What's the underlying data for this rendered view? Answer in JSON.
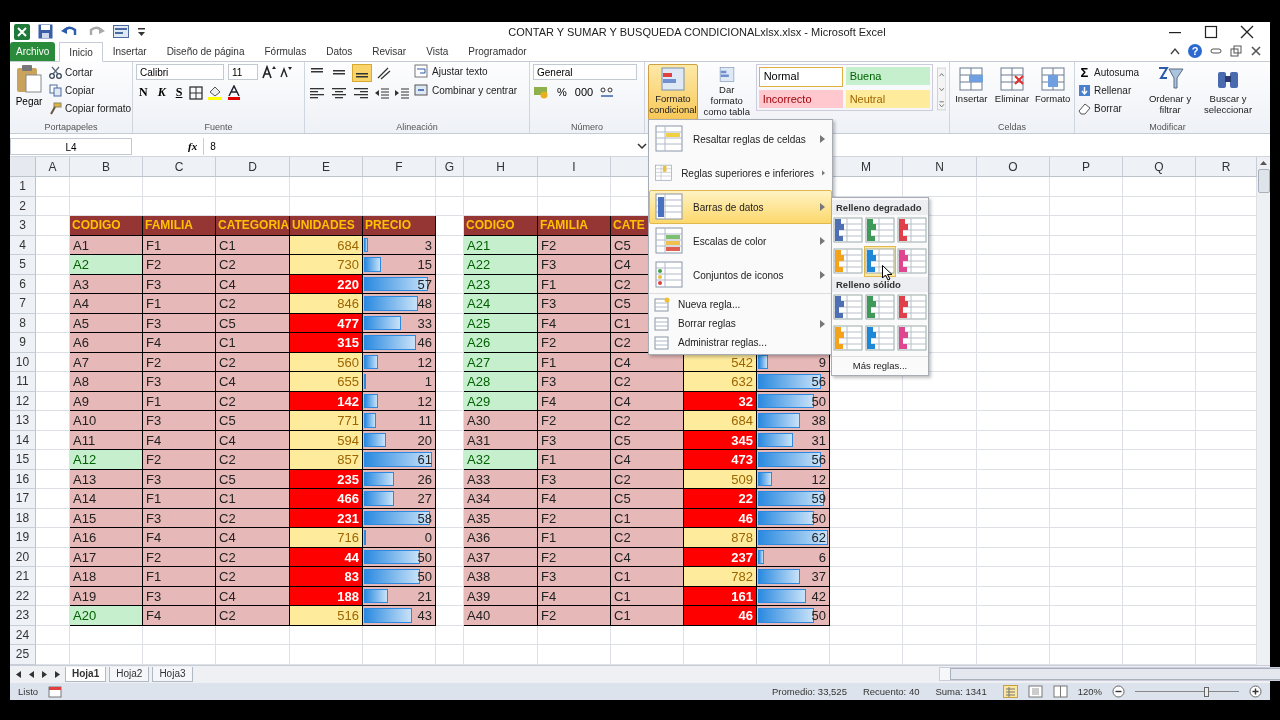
{
  "window": {
    "title": "CONTAR Y SUMAR Y BUSQUEDA CONDICIONALxlsx.xlsx  -  Microsoft Excel",
    "help": "?"
  },
  "tabs": [
    {
      "label": "Archivo",
      "kind": "file",
      "selected": false
    },
    {
      "label": "Inicio",
      "kind": "tab",
      "selected": true
    },
    {
      "label": "Insertar",
      "kind": "tab",
      "selected": false
    },
    {
      "label": "Diseño de página",
      "kind": "tab",
      "selected": false
    },
    {
      "label": "Fórmulas",
      "kind": "tab",
      "selected": false
    },
    {
      "label": "Datos",
      "kind": "tab",
      "selected": false
    },
    {
      "label": "Revisar",
      "kind": "tab",
      "selected": false
    },
    {
      "label": "Vista",
      "kind": "tab",
      "selected": false
    },
    {
      "label": "Programador",
      "kind": "tab",
      "selected": false
    }
  ],
  "ribbon": {
    "clipboard": {
      "paste": "Pegar",
      "items": [
        "Cortar",
        "Copiar",
        "Copiar formato"
      ],
      "label": "Portapapeles"
    },
    "font": {
      "family": "Calibri",
      "size": "11",
      "style_buttons": [
        "N",
        "K",
        "S"
      ],
      "label": "Fuente"
    },
    "alignment": {
      "wrap": "Ajustar texto",
      "merge": "Combinar y centrar",
      "label": "Alineación"
    },
    "number": {
      "format": "General",
      "symbols": [
        "%",
        "000"
      ],
      "label": "Número"
    },
    "styles": {
      "buttons": [
        {
          "label": "Formato condicional",
          "selected": true
        },
        {
          "label": "Dar formato como tabla",
          "selected": false
        }
      ],
      "cell_styles": [
        {
          "label": "Normal",
          "kind": "normal"
        },
        {
          "label": "Buena",
          "kind": "good"
        },
        {
          "label": "Incorrecto",
          "kind": "bad"
        },
        {
          "label": "Neutral",
          "kind": "neutral"
        }
      ]
    },
    "cells": {
      "buttons": [
        "Insertar",
        "Eliminar",
        "Formato"
      ],
      "label": "Celdas"
    },
    "editing": {
      "autosum_symbol": "Σ",
      "items": [
        "Autosuma",
        "Rellenar",
        "Borrar"
      ],
      "buttons": [
        "Ordenar y filtrar",
        "Buscar y seleccionar"
      ],
      "label": "Modificar"
    }
  },
  "formula_bar": {
    "name_box": "L4",
    "function_label": "fx",
    "value": "8"
  },
  "sheet": {
    "columns": [
      "A",
      "B",
      "C",
      "D",
      "E",
      "F",
      "G",
      "H",
      "I",
      null,
      null,
      null,
      "M",
      "N",
      "O",
      "P",
      "Q",
      "R"
    ],
    "rows": [
      "1",
      "2",
      "3",
      "4",
      "5",
      "6",
      "7",
      "8",
      "9",
      "10",
      "11",
      "12",
      "13",
      "14",
      "15",
      "16",
      "17",
      "18",
      "19",
      "20",
      "21",
      "22",
      "23",
      "24",
      "25"
    ]
  },
  "tables": [
    {
      "columns": [
        "CODIGO",
        "FAMILIA",
        "CATEGORIA",
        "UNIDADES",
        "PRECIO"
      ],
      "rows": [
        {
          "code": "A1",
          "highlight": false,
          "family": "F1",
          "category": "C1",
          "units": "684",
          "low": false,
          "price": "3",
          "level": 0.05
        },
        {
          "code": "A2",
          "highlight": true,
          "family": "F2",
          "category": "C2",
          "units": "730",
          "low": false,
          "price": "15",
          "level": 0.23
        },
        {
          "code": "A3",
          "highlight": false,
          "family": "F3",
          "category": "C4",
          "units": "220",
          "low": true,
          "price": "57",
          "level": 0.89
        },
        {
          "code": "A4",
          "highlight": false,
          "family": "F1",
          "category": "C2",
          "units": "846",
          "low": false,
          "price": "48",
          "level": 0.75
        },
        {
          "code": "A5",
          "highlight": false,
          "family": "F3",
          "category": "C5",
          "units": "477",
          "low": true,
          "price": "33",
          "level": 0.52
        },
        {
          "code": "A6",
          "highlight": false,
          "family": "F4",
          "category": "C1",
          "units": "315",
          "low": true,
          "price": "46",
          "level": 0.72
        },
        {
          "code": "A7",
          "highlight": false,
          "family": "F2",
          "category": "C2",
          "units": "560",
          "low": false,
          "price": "12",
          "level": 0.19
        },
        {
          "code": "A8",
          "highlight": false,
          "family": "F3",
          "category": "C4",
          "units": "655",
          "low": false,
          "price": "1",
          "level": 0.03
        },
        {
          "code": "A9",
          "highlight": false,
          "family": "F1",
          "category": "C2",
          "units": "142",
          "low": true,
          "price": "12",
          "level": 0.19
        },
        {
          "code": "A10",
          "highlight": false,
          "family": "F3",
          "category": "C5",
          "units": "771",
          "low": false,
          "price": "11",
          "level": 0.17
        },
        {
          "code": "A11",
          "highlight": false,
          "family": "F4",
          "category": "C4",
          "units": "594",
          "low": false,
          "price": "20",
          "level": 0.31
        },
        {
          "code": "A12",
          "highlight": true,
          "family": "F2",
          "category": "C2",
          "units": "857",
          "low": false,
          "price": "61",
          "level": 0.95
        },
        {
          "code": "A13",
          "highlight": false,
          "family": "F3",
          "category": "C5",
          "units": "235",
          "low": true,
          "price": "26",
          "level": 0.41
        },
        {
          "code": "A14",
          "highlight": false,
          "family": "F1",
          "category": "C1",
          "units": "466",
          "low": true,
          "price": "27",
          "level": 0.42
        },
        {
          "code": "A15",
          "highlight": false,
          "family": "F3",
          "category": "C2",
          "units": "231",
          "low": true,
          "price": "58",
          "level": 0.91
        },
        {
          "code": "A16",
          "highlight": false,
          "family": "F4",
          "category": "C4",
          "units": "716",
          "low": false,
          "price": "0",
          "level": 0.02
        },
        {
          "code": "A17",
          "highlight": false,
          "family": "F2",
          "category": "C2",
          "units": "44",
          "low": true,
          "price": "50",
          "level": 0.78
        },
        {
          "code": "A18",
          "highlight": false,
          "family": "F1",
          "category": "C2",
          "units": "83",
          "low": true,
          "price": "50",
          "level": 0.78
        },
        {
          "code": "A19",
          "highlight": false,
          "family": "F3",
          "category": "C4",
          "units": "188",
          "low": true,
          "price": "21",
          "level": 0.33
        },
        {
          "code": "A20",
          "highlight": true,
          "family": "F4",
          "category": "C2",
          "units": "516",
          "low": false,
          "price": "43",
          "level": 0.67
        }
      ]
    },
    {
      "columns": [
        "CODIGO",
        "FAMILIA",
        "CATE"
      ],
      "rows": [
        {
          "code": "A21",
          "highlight": true,
          "family": "F2",
          "category": "C5"
        },
        {
          "code": "A22",
          "highlight": true,
          "family": "F3",
          "category": "C4"
        },
        {
          "code": "A23",
          "highlight": true,
          "family": "F1",
          "category": "C2"
        },
        {
          "code": "A24",
          "highlight": true,
          "family": "F3",
          "category": "C5"
        },
        {
          "code": "A25",
          "highlight": true,
          "family": "F4",
          "category": "C1"
        },
        {
          "code": "A26",
          "highlight": true,
          "family": "F2",
          "category": "C2"
        },
        {
          "code": "A27",
          "highlight": true,
          "family": "F1",
          "category": "C4",
          "units": "542",
          "low": false,
          "price": "9",
          "level": 0.14
        },
        {
          "code": "A28",
          "highlight": true,
          "family": "F3",
          "category": "C2",
          "units": "632",
          "low": false,
          "price": "56",
          "level": 0.88
        },
        {
          "code": "A29",
          "highlight": true,
          "family": "F4",
          "category": "C4",
          "units": "32",
          "low": true,
          "price": "50",
          "level": 0.78
        },
        {
          "code": "A30",
          "highlight": false,
          "family": "F2",
          "category": "C2",
          "units": "684",
          "low": false,
          "price": "38",
          "level": 0.59
        },
        {
          "code": "A31",
          "highlight": false,
          "family": "F3",
          "category": "C5",
          "units": "345",
          "low": true,
          "price": "31",
          "level": 0.48
        },
        {
          "code": "A32",
          "highlight": true,
          "family": "F1",
          "category": "C4",
          "units": "473",
          "low": true,
          "price": "56",
          "level": 0.88
        },
        {
          "code": "A33",
          "highlight": false,
          "family": "F3",
          "category": "C2",
          "units": "509",
          "low": false,
          "price": "12",
          "level": 0.19
        },
        {
          "code": "A34",
          "highlight": false,
          "family": "F4",
          "category": "C5",
          "units": "22",
          "low": true,
          "price": "59",
          "level": 0.92
        },
        {
          "code": "A35",
          "highlight": false,
          "family": "F2",
          "category": "C1",
          "units": "46",
          "low": true,
          "price": "50",
          "level": 0.78
        },
        {
          "code": "A36",
          "highlight": false,
          "family": "F1",
          "category": "C2",
          "units": "878",
          "low": false,
          "price": "62",
          "level": 0.97
        },
        {
          "code": "A37",
          "highlight": false,
          "family": "F2",
          "category": "C4",
          "units": "237",
          "low": true,
          "price": "6",
          "level": 0.09
        },
        {
          "code": "A38",
          "highlight": false,
          "family": "F3",
          "category": "C1",
          "units": "782",
          "low": false,
          "price": "37",
          "level": 0.58
        },
        {
          "code": "A39",
          "highlight": false,
          "family": "F4",
          "category": "C1",
          "units": "161",
          "low": true,
          "price": "42",
          "level": 0.66
        },
        {
          "code": "A40",
          "highlight": false,
          "family": "F2",
          "category": "C1",
          "units": "46",
          "low": true,
          "price": "50",
          "level": 0.78
        }
      ]
    }
  ],
  "menu": {
    "items": [
      {
        "label": "Resaltar reglas de celdas",
        "kind": "big",
        "submenu": true,
        "selected": false
      },
      {
        "label": "Reglas superiores e inferiores",
        "kind": "big",
        "submenu": true,
        "selected": false
      },
      {
        "label": "Barras de datos",
        "kind": "big",
        "submenu": true,
        "selected": true
      },
      {
        "label": "Escalas de color",
        "kind": "big",
        "submenu": true,
        "selected": false
      },
      {
        "label": "Conjuntos de iconos",
        "kind": "big",
        "submenu": true,
        "selected": false
      },
      {
        "label": "Nueva regla...",
        "kind": "small",
        "submenu": false,
        "selected": false
      },
      {
        "label": "Borrar reglas",
        "kind": "small",
        "submenu": true,
        "selected": false
      },
      {
        "label": "Administrar reglas...",
        "kind": "small",
        "submenu": false,
        "selected": false
      }
    ],
    "submenu": {
      "sections": [
        {
          "title": "Relleno degradado",
          "swatches": [
            {
              "color": "#4f6fb5",
              "selected": false
            },
            {
              "color": "#3f9a5a",
              "selected": false
            },
            {
              "color": "#e0404a",
              "selected": false
            },
            {
              "color": "#f4a21a",
              "selected": false
            },
            {
              "color": "#1e88d8",
              "selected": true
            },
            {
              "color": "#e0458f",
              "selected": false
            }
          ]
        },
        {
          "title": "Relleno sólido",
          "swatches": [
            {
              "color": "#4f6fb5",
              "selected": false
            },
            {
              "color": "#3f9a5a",
              "selected": false
            },
            {
              "color": "#e0404a",
              "selected": false
            },
            {
              "color": "#f4a21a",
              "selected": false
            },
            {
              "color": "#1e88d8",
              "selected": false
            },
            {
              "color": "#e0458f",
              "selected": false
            }
          ]
        }
      ],
      "more": "Más reglas..."
    }
  },
  "sheet_tabs": [
    {
      "label": "Hoja1",
      "selected": true
    },
    {
      "label": "Hoja2",
      "selected": false
    },
    {
      "label": "Hoja3",
      "selected": false
    }
  ],
  "status_bar": {
    "mode": "Listo",
    "stats": [
      "Promedio: 33,525",
      "Recuento: 40",
      "Suma: 1341"
    ],
    "zoom": "120%",
    "zoom_slider": {
      "level": 0.68
    }
  }
}
